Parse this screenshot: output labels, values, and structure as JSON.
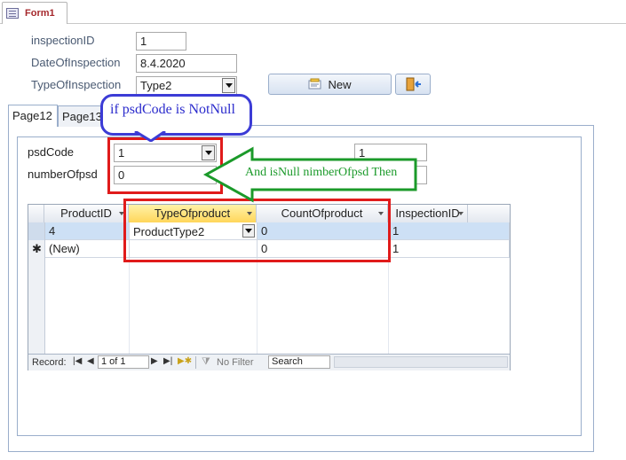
{
  "document_tab": {
    "label": "Form1",
    "icon": "form-icon"
  },
  "fields": {
    "inspection_id": {
      "label": "inspectionID",
      "value": "1"
    },
    "date_of_inspection": {
      "label": "DateOfInspection",
      "value": "8.4.2020"
    },
    "type_of_inspection": {
      "label": "TypeOfInspection",
      "value": "Type2"
    }
  },
  "buttons": {
    "new_label": "New",
    "new_icon": "new-record-icon",
    "exit_icon": "exit-door-icon"
  },
  "form_tabs": [
    {
      "label": "Page12"
    },
    {
      "label": "Page13"
    }
  ],
  "subform": {
    "psd_code": {
      "label": "psdCode",
      "value": "1"
    },
    "number_of_psd": {
      "label": "numberOfpsd",
      "value": "0"
    },
    "right_value": "1"
  },
  "datasheet": {
    "columns": [
      "ProductID",
      "TypeOfproduct",
      "CountOfproduct",
      "InspectionID"
    ],
    "rows": [
      {
        "product_id": "4",
        "type_of_product": "ProductType2",
        "count_of_product": "0",
        "inspection_id": "1"
      },
      {
        "product_id": "(New)",
        "type_of_product": "",
        "count_of_product": "0",
        "inspection_id": "1"
      }
    ],
    "new_row_marker": "✱",
    "nav": {
      "record_label": "Record:",
      "position": "1 of 1",
      "filter_label": "No Filter",
      "search_placeholder": "Search"
    }
  },
  "annotations": {
    "bubble_text": "if psdCode is NotNull",
    "arrow_text": "And isNull nimberOfpsd Then",
    "colors": {
      "red": "#e01b1b",
      "blue": "#3c3cd6",
      "green": "#1b9a2a"
    }
  }
}
